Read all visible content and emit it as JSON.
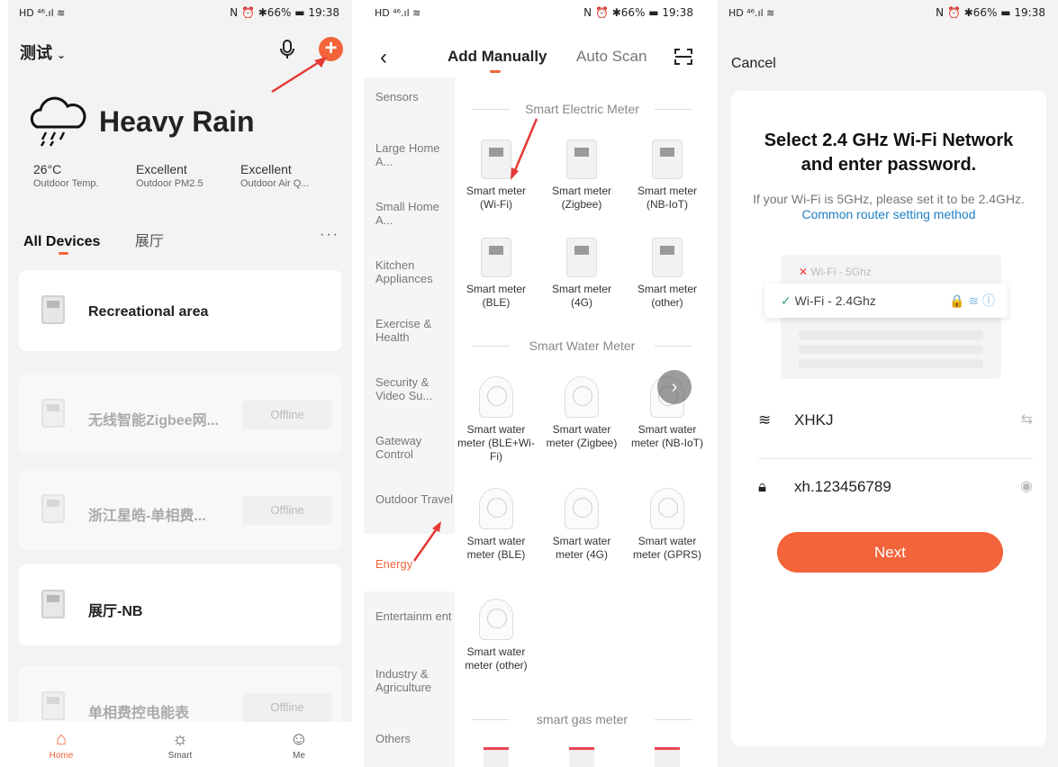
{
  "status": {
    "left": "HD ⁴⁶.ıl ≋",
    "right": "N ⏰ ✱66% ▬ 19:38"
  },
  "home": {
    "title": "测试",
    "weather": "Heavy Rain",
    "stats": [
      {
        "value": "26°C",
        "label": "Outdoor Temp."
      },
      {
        "value": "Excellent",
        "label": "Outdoor PM2.5"
      },
      {
        "value": "Excellent",
        "label": "Outdoor Air Q..."
      }
    ],
    "tabs": [
      "All Devices",
      "展厅"
    ],
    "more": "···",
    "devices": [
      {
        "name": "Recreational area",
        "status": ""
      },
      {
        "name": "无线智能Zigbee网...",
        "status": "Offline"
      },
      {
        "name": "浙江星皓-单相费...",
        "status": "Offline"
      },
      {
        "name": "展厅-NB",
        "status": ""
      },
      {
        "name": "单相费控电能表",
        "status": "Offline"
      }
    ],
    "nav": [
      "Home",
      "Smart",
      "Me"
    ],
    "accent": "#f4643a"
  },
  "add": {
    "tabs": [
      "Add Manually",
      "Auto Scan"
    ],
    "categories": [
      "Sensors",
      "Large Home A...",
      "Small Home A...",
      "Kitchen Appliances",
      "Exercise & Health",
      "Security & Video Su...",
      "Gateway Control",
      "Outdoor Travel",
      "Energy",
      "Entertainm ent",
      "Industry & Agriculture",
      "Others"
    ],
    "sections": [
      "Smart Electric Meter",
      "Smart Water Meter",
      "smart gas meter"
    ],
    "electric": [
      "Smart meter (Wi-Fi)",
      "Smart meter (Zigbee)",
      "Smart meter (NB-IoT)",
      "Smart meter (BLE)",
      "Smart meter (4G)",
      "Smart meter (other)"
    ],
    "water": [
      "Smart water meter (BLE+Wi-Fi)",
      "Smart water meter (Zigbee)",
      "Smart water meter (NB-IoT)",
      "Smart water meter (BLE)",
      "Smart water meter (4G)",
      "Smart water meter (GPRS)",
      "Smart water meter (other)"
    ]
  },
  "wifi": {
    "cancel": "Cancel",
    "title": "Select 2.4 GHz Wi-Fi Network and enter password.",
    "hint": "If your Wi-Fi is 5GHz, please set it to be 2.4GHz.",
    "hint_link": "Common router setting method",
    "bad": "Wi-Fi - 5Ghz",
    "good": "Wi-Fi - 2.4Ghz",
    "ssid": "XHKJ",
    "password": "xh.123456789",
    "next": "Next"
  }
}
